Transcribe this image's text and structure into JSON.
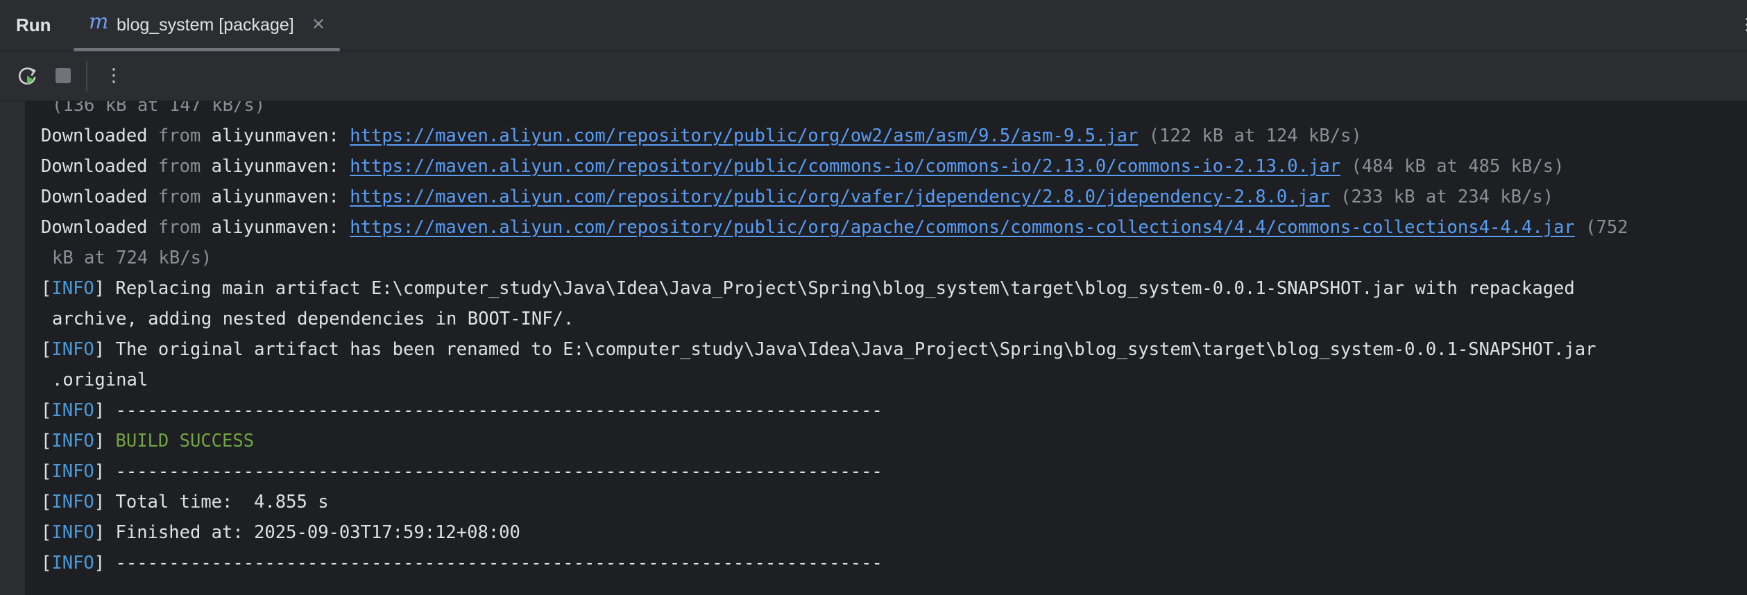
{
  "window": {
    "run_label": "Run",
    "tab": {
      "icon_glyph": "m",
      "title": "blog_system [package]",
      "close_glyph": "✕"
    },
    "options_glyph": "⋮"
  },
  "toolbar": {
    "rerun": "rerun-icon",
    "stop": "stop-icon",
    "more_glyph": "⋮"
  },
  "colors": {
    "link": "#589df6",
    "info": "#4a9ad9",
    "success": "#6fa542",
    "dim": "#8c8f94"
  },
  "console": {
    "partial_top": "(136 kB at 147 kB/s)",
    "downloads": [
      {
        "prefix": "Downloaded",
        "from": "from",
        "repo": "aliyunmaven:",
        "url": "https://maven.aliyun.com/repository/public/org/ow2/asm/asm/9.5/asm-9.5.jar",
        "size": "(122 kB at 124 kB/s)"
      },
      {
        "prefix": "Downloaded",
        "from": "from",
        "repo": "aliyunmaven:",
        "url": "https://maven.aliyun.com/repository/public/commons-io/commons-io/2.13.0/commons-io-2.13.0.jar",
        "size": "(484 kB at 485 kB/s)"
      },
      {
        "prefix": "Downloaded",
        "from": "from",
        "repo": "aliyunmaven:",
        "url": "https://maven.aliyun.com/repository/public/org/vafer/jdependency/2.8.0/jdependency-2.8.0.jar",
        "size": "(233 kB at 234 kB/s)"
      },
      {
        "prefix": "Downloaded",
        "from": "from",
        "repo": "aliyunmaven:",
        "url": "https://maven.aliyun.com/repository/public/org/apache/commons/commons-collections4/4.4/commons-collections4-4.4.jar",
        "size": "(752",
        "size_cont": "kB at 724 kB/s)"
      }
    ],
    "info_tag": "INFO",
    "open_bracket": "[",
    "close_bracket": "]",
    "replacing_1": "Replacing main artifact E:\\computer_study\\Java\\Idea\\Java_Project\\Spring\\blog_system\\target\\blog_system-0.0.1-SNAPSHOT.jar with repackaged",
    "replacing_2": "archive, adding nested dependencies in BOOT-INF/.",
    "renamed_1": "The original artifact has been renamed to E:\\computer_study\\Java\\Idea\\Java_Project\\Spring\\blog_system\\target\\blog_system-0.0.1-SNAPSHOT.jar",
    "renamed_2": ".original",
    "separator": "------------------------------------------------------------------------",
    "build_success": "BUILD SUCCESS",
    "total_time": "Total time:  4.855 s",
    "finished_at": "Finished at: 2025-09-03T17:59:12+08:00"
  }
}
